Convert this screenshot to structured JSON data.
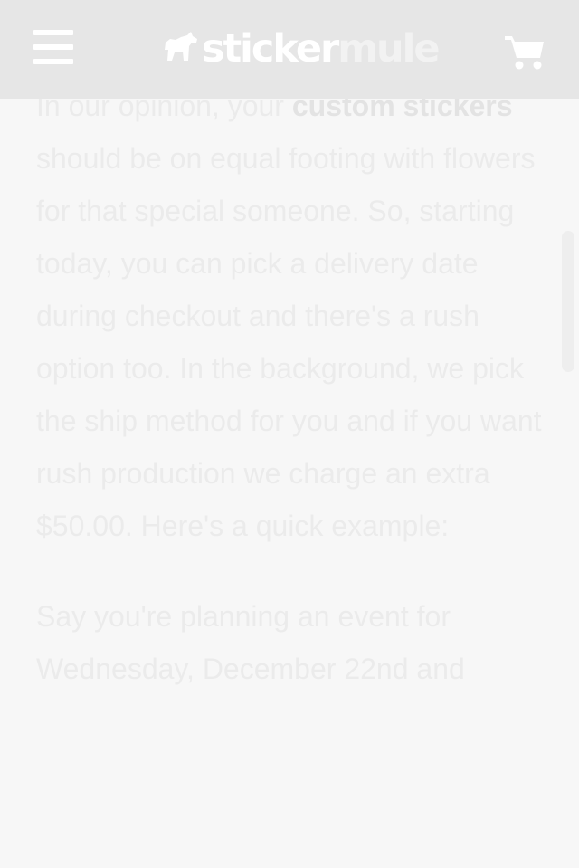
{
  "header": {
    "logo_part1": "sticker",
    "logo_part2": "mule",
    "menu_icon": "hamburger-menu-icon",
    "cart_icon": "shopping-cart-icon"
  },
  "article": {
    "p1_pre": "In our opinion, your ",
    "p1_link": "custom stickers",
    "p1_post": " should be on equal footing with flowers for that special someone. So, starting today, you can pick a delivery date during checkout and there's a rush option too. In the background, we pick the ship method for you and if you want rush production we charge an extra $50.00. Here's a quick example:",
    "p2": "Say you're planning an event for Wednesday, December 22nd and"
  },
  "colors": {
    "header_bg": "#e6e6e6",
    "page_bg": "#f7f7f7",
    "text": "#ebebeb"
  }
}
